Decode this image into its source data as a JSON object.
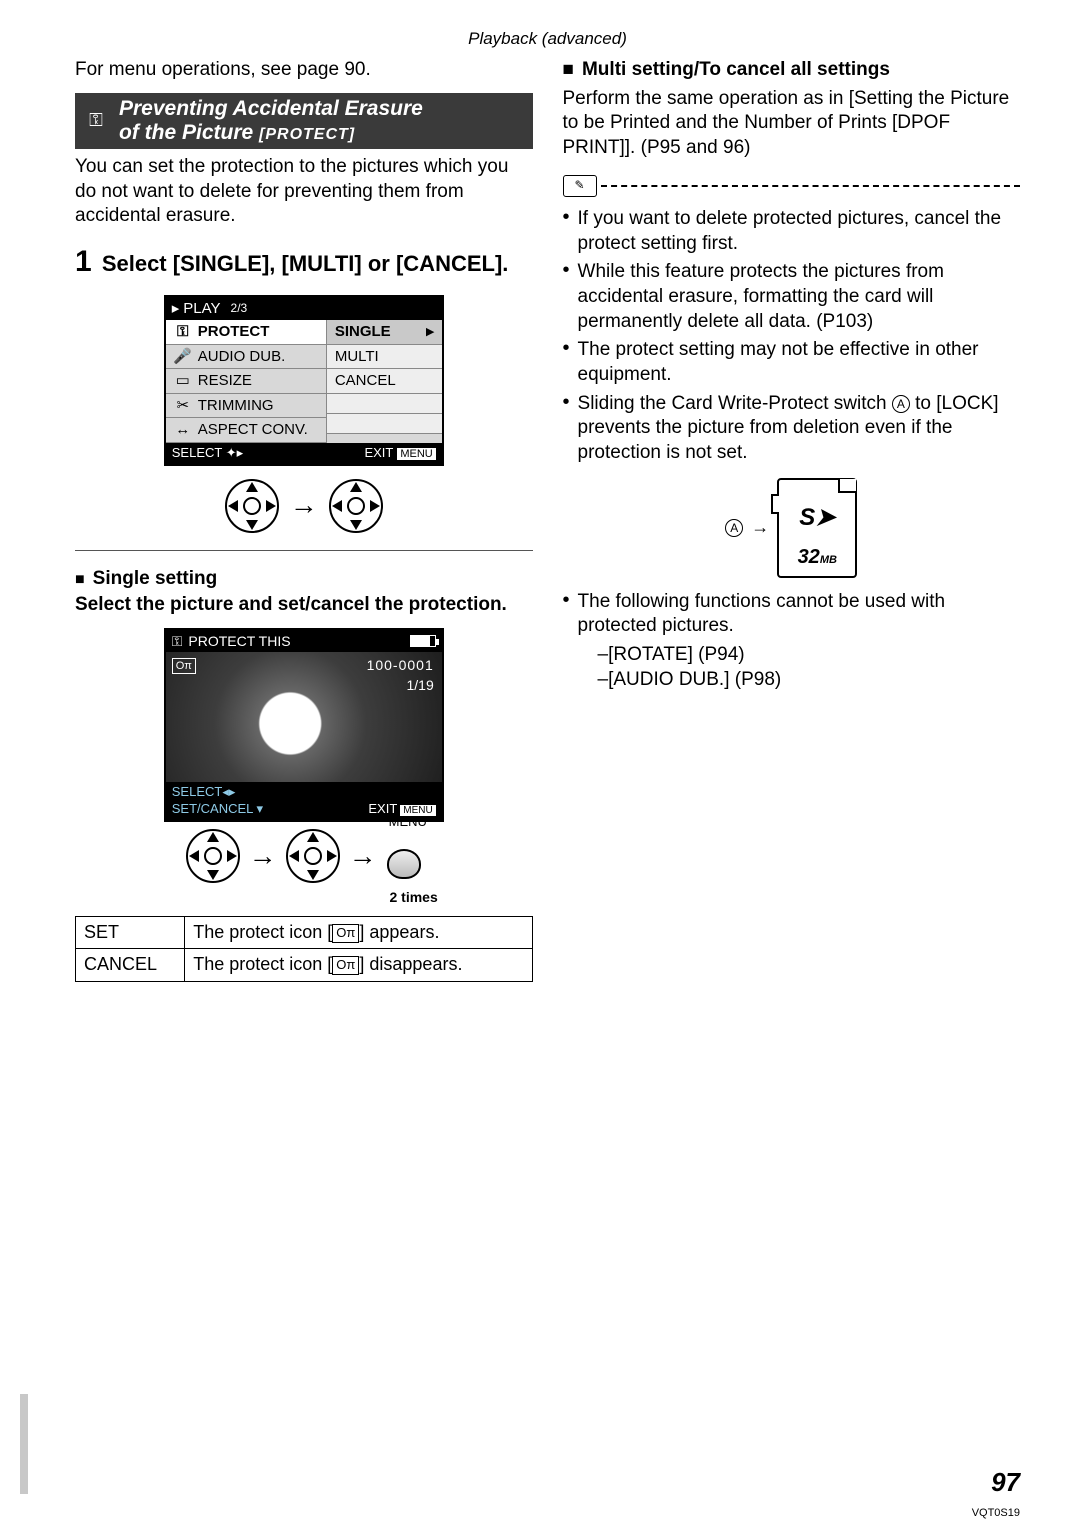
{
  "header": {
    "section": "Playback (advanced)"
  },
  "left": {
    "intro": "For menu operations, see page 90.",
    "banner": {
      "line1": "Preventing Accidental Erasure",
      "line2_a": "of the Picture ",
      "line2_b": "[PROTECT]"
    },
    "banner_desc": "You can set the protection to the pictures which you do not want to delete for preventing them from accidental erasure.",
    "step1_num": "1",
    "step1": "Select [SINGLE], [MULTI] or [CANCEL].",
    "menu": {
      "play_label": "PLAY",
      "play_page": "2/3",
      "items": [
        "PROTECT",
        "AUDIO DUB.",
        "RESIZE",
        "TRIMMING",
        "ASPECT CONV."
      ],
      "options": [
        "SINGLE",
        "MULTI",
        "CANCEL"
      ],
      "select": "SELECT",
      "exit": "EXIT",
      "menu_tag": "MENU"
    },
    "single_heading": "Single setting",
    "single_instr": "Select the picture and set/cancel the protection.",
    "screen": {
      "title": "PROTECT THIS",
      "badge": "Oπ",
      "fileno": "100-0001",
      "counter": "1/19",
      "select": "SELECT",
      "setcancel": "SET/CANCEL",
      "exit": "EXIT",
      "menu_tag": "MENU",
      "menu_label": "MENU",
      "two_times": "2 times"
    },
    "result_table": {
      "r1a": "SET",
      "r1b_pre": "The protect icon [",
      "r1b_post": "] appears.",
      "r2a": "CANCEL",
      "r2b_pre": "The protect icon [",
      "r2b_post": "] disappears."
    }
  },
  "right": {
    "heading": "Multi setting/To cancel all settings",
    "para1": "Perform the same operation as in [Setting the Picture to be Printed and the Number of Prints [DPOF PRINT]]. (P95 and 96)",
    "bullets": [
      "If you want to delete protected pictures, cancel the protect setting first.",
      "While this feature protects the pictures from accidental erasure, formatting the card will permanently delete all data. (P103)",
      "The protect setting may not be effective in other equipment.",
      "Sliding the Card Write-Protect switch Ⓐ to [LOCK] prevents the picture from deletion even if the protection is not set."
    ],
    "sd": {
      "label_a": "A",
      "logo": "S➤",
      "size_num": "32",
      "size_unit": "MB"
    },
    "bullet5": "The following functions cannot be used with protected pictures.",
    "sub": [
      "–[ROTATE] (P94)",
      "–[AUDIO DUB.] (P98)"
    ]
  },
  "footer": {
    "page": "97",
    "doc": "VQT0S19"
  }
}
